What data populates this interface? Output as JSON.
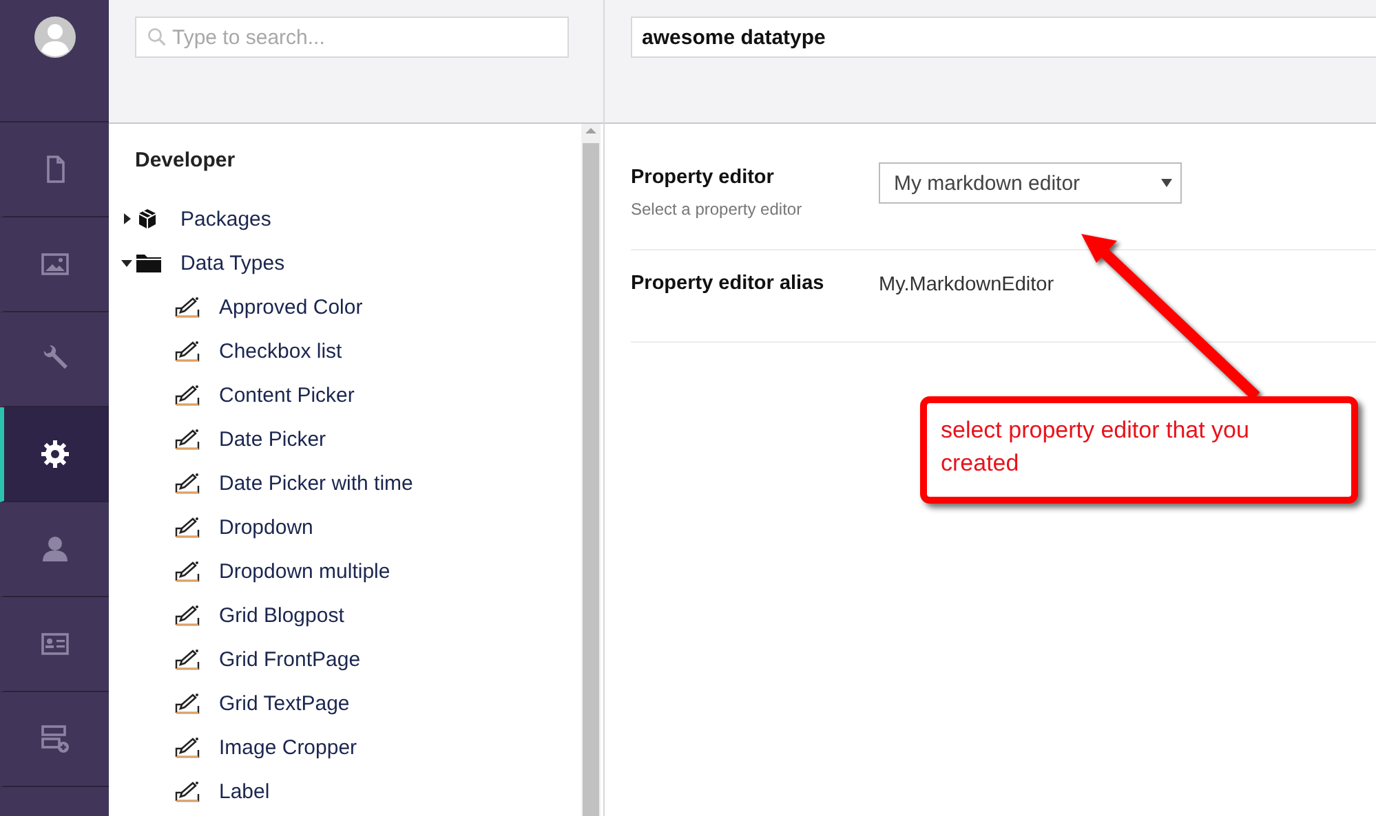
{
  "nav": {
    "sections": [
      {
        "kind": "document",
        "selected": false
      },
      {
        "kind": "image",
        "selected": false
      },
      {
        "kind": "wrench",
        "selected": false
      },
      {
        "kind": "gear",
        "selected": true
      },
      {
        "kind": "user",
        "selected": false
      },
      {
        "kind": "card",
        "selected": false
      },
      {
        "kind": "form",
        "selected": false
      }
    ]
  },
  "tree": {
    "search": {
      "placeholder": "Type to search..."
    },
    "title": "Developer",
    "items": [
      {
        "label": "Packages",
        "kind": "package",
        "expanded": false
      },
      {
        "label": "Data Types",
        "kind": "folder",
        "expanded": true,
        "children": [
          {
            "label": "Approved Color",
            "kind": "datatype"
          },
          {
            "label": "Checkbox list",
            "kind": "datatype"
          },
          {
            "label": "Content Picker",
            "kind": "datatype"
          },
          {
            "label": "Date Picker",
            "kind": "datatype"
          },
          {
            "label": "Date Picker with time",
            "kind": "datatype"
          },
          {
            "label": "Dropdown",
            "kind": "datatype"
          },
          {
            "label": "Dropdown multiple",
            "kind": "datatype"
          },
          {
            "label": "Grid Blogpost",
            "kind": "datatype"
          },
          {
            "label": "Grid FrontPage",
            "kind": "datatype"
          },
          {
            "label": "Grid TextPage",
            "kind": "datatype"
          },
          {
            "label": "Image Cropper",
            "kind": "datatype"
          },
          {
            "label": "Label",
            "kind": "datatype"
          }
        ]
      }
    ]
  },
  "editor": {
    "name": "awesome datatype",
    "properties": [
      {
        "label": "Property editor",
        "description": "Select a property editor",
        "kind": "dropdown",
        "value": "My markdown editor"
      },
      {
        "label": "Property editor alias",
        "kind": "text",
        "value": "My.MarkdownEditor"
      }
    ]
  },
  "annotation": {
    "text": "select property editor that you created"
  }
}
